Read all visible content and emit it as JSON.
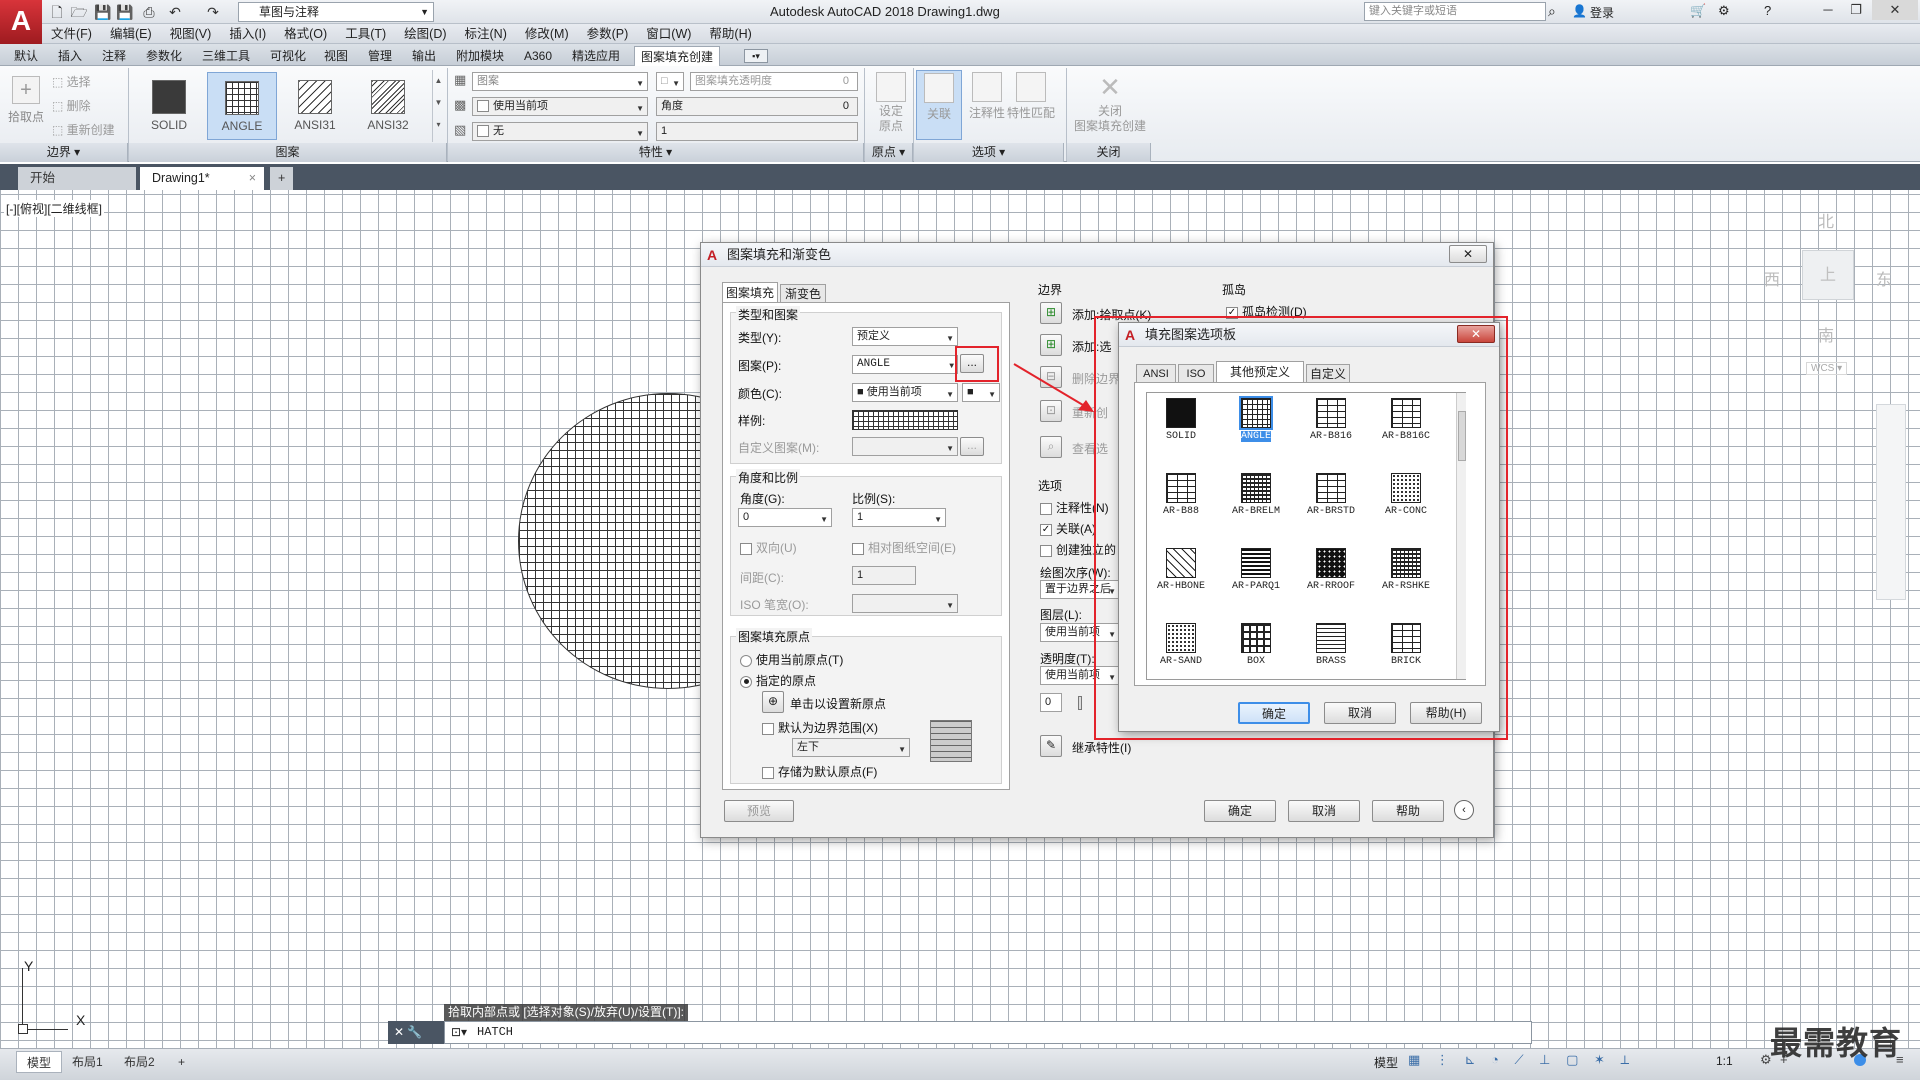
{
  "app": {
    "logo_letter": "A",
    "workspace": "草图与注释",
    "title": "Autodesk AutoCAD 2018    Drawing1.dwg",
    "search_placeholder": "键入关键字或短语",
    "login": "登录"
  },
  "menu": [
    "文件(F)",
    "编辑(E)",
    "视图(V)",
    "插入(I)",
    "格式(O)",
    "工具(T)",
    "绘图(D)",
    "标注(N)",
    "修改(M)",
    "参数(P)",
    "窗口(W)",
    "帮助(H)"
  ],
  "ribbon_tabs": [
    "默认",
    "插入",
    "注释",
    "参数化",
    "三维工具",
    "可视化",
    "视图",
    "管理",
    "输出",
    "附加模块",
    "A360",
    "精选应用",
    "图案填充创建"
  ],
  "ribbon": {
    "boundary": {
      "pick_point": "拾取点",
      "select": "选择",
      "remove": "删除",
      "recreate": "重新创建",
      "footer": "边界 ▾"
    },
    "patterns": [
      {
        "name": "SOLID"
      },
      {
        "name": "ANGLE"
      },
      {
        "name": "ANSI31"
      },
      {
        "name": "ANSI32"
      }
    ],
    "pattern_footer": "图案",
    "props": {
      "type": "图案",
      "transparency": "图案填充透明度",
      "transparency_val": "0",
      "use_current": "使用当前项",
      "angle": "角度",
      "angle_val": "0",
      "none": "无",
      "scale_val": "1",
      "footer": "特性 ▾"
    },
    "origin": {
      "set_origin": "设定\n原点",
      "footer": "原点 ▾"
    },
    "options": {
      "associative": "关联",
      "annotative": "注释性",
      "match": "特性匹配",
      "footer": "选项 ▾"
    },
    "close": {
      "label": "关闭\n图案填充创建",
      "footer": "关闭"
    }
  },
  "doc_tabs": {
    "start": "开始",
    "drawing": "Drawing1*",
    "close": "×",
    "add": "+"
  },
  "viewport_label": "[-][俯视][二维线框]",
  "viewcube": {
    "north": "北",
    "south": "南",
    "east": "东",
    "west": "西",
    "top": "上",
    "wcs": "WCS ▾"
  },
  "ucs": {
    "x": "X",
    "y": "Y"
  },
  "hatch_dialog": {
    "title": "图案填充和渐变色",
    "tabs": [
      "图案填充",
      "渐变色"
    ],
    "type_and_pattern": "类型和图案",
    "type_label": "类型(Y):",
    "type_value": "预定义",
    "pattern_label": "图案(P):",
    "pattern_value": "ANGLE",
    "browse": "...",
    "color_label": "颜色(C):",
    "color_value": "■ 使用当前项",
    "swatch_label": "样例:",
    "custom_label": "自定义图案(M):",
    "angle_scale": "角度和比例",
    "angle_label": "角度(G):",
    "angle_value": "0",
    "scale_label": "比例(S):",
    "scale_value": "1",
    "double": "双向(U)",
    "relative": "相对图纸空间(E)",
    "spacing_label": "间距(C):",
    "spacing_value": "1",
    "iso_label": "ISO 笔宽(O):",
    "origin_group": "图案填充原点",
    "use_current_origin": "使用当前原点(T)",
    "specified_origin": "指定的原点",
    "click_set_origin": "单击以设置新原点",
    "default_extents": "默认为边界范围(X)",
    "extents_value": "左下",
    "store_default": "存储为默认原点(F)",
    "boundaries": "边界",
    "add_pick": "添加:拾取点(K)",
    "add_select": "添加:选",
    "remove_bound": "删除边界",
    "recreate_bound": "重新创",
    "view_select": "查看选",
    "islands": "孤岛",
    "island_detect": "孤岛检测(D)",
    "options": "选项",
    "annotative": "注释性(N)",
    "associative": "关联(A)",
    "create_separate": "创建独立的",
    "draw_order": "绘图次序(W):",
    "draw_order_value": "置于边界之后",
    "layer": "图层(L):",
    "layer_value": "使用当前项",
    "transparency": "透明度(T):",
    "transparency_value": "使用当前项",
    "transparency_num": "0",
    "inherit": "继承特性(I)",
    "preview": "预览",
    "ok": "确定",
    "cancel": "取消",
    "help": "帮助"
  },
  "palette_dialog": {
    "title": "填充图案选项板",
    "tabs": [
      "ANSI",
      "ISO",
      "其他预定义",
      "自定义"
    ],
    "patterns": [
      {
        "name": "SOLID",
        "style": "solid"
      },
      {
        "name": "ANGLE",
        "style": "angle"
      },
      {
        "name": "AR-B816",
        "style": "brick"
      },
      {
        "name": "AR-B816C",
        "style": "brick"
      },
      {
        "name": "AR-B88",
        "style": "brick"
      },
      {
        "name": "AR-BRELM",
        "style": "dense"
      },
      {
        "name": "AR-BRSTD",
        "style": "brick"
      },
      {
        "name": "AR-CONC",
        "style": "dots"
      },
      {
        "name": "AR-HBONE",
        "style": "herring"
      },
      {
        "name": "AR-PARQ1",
        "style": "parq"
      },
      {
        "name": "AR-RROOF",
        "style": "roof"
      },
      {
        "name": "AR-RSHKE",
        "style": "dense"
      },
      {
        "name": "AR-SAND",
        "style": "dots"
      },
      {
        "name": "BOX",
        "style": "box"
      },
      {
        "name": "BRASS",
        "style": "lines"
      },
      {
        "name": "BRICK",
        "style": "brick"
      }
    ],
    "ok": "确定",
    "cancel": "取消",
    "help": "帮助(H)"
  },
  "command": {
    "prompt": "拾取内部点或 [选择对象(S)/放弃(U)/设置(T)]:",
    "input": "HATCH"
  },
  "status": {
    "tabs": [
      "模型",
      "布局1",
      "布局2"
    ],
    "add": "+",
    "model": "模型",
    "scale": "1:1"
  },
  "watermark": "最需教育",
  "colors": {
    "accent": "#3d8ee8",
    "highlight_red": "#e3232b",
    "brand_red": "#c41e25"
  }
}
